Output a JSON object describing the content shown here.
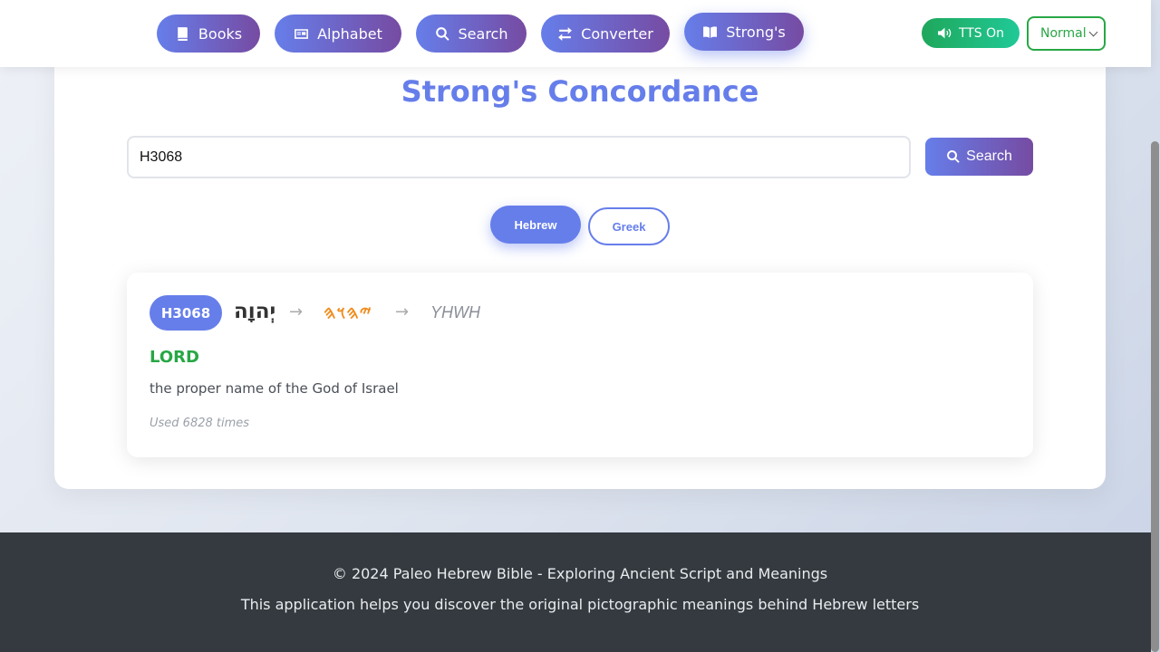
{
  "nav": {
    "items": [
      {
        "label": "Books",
        "icon": "book-icon"
      },
      {
        "label": "Alphabet",
        "icon": "id-card-icon"
      },
      {
        "label": "Search",
        "icon": "search-icon"
      },
      {
        "label": "Converter",
        "icon": "exchange-icon"
      },
      {
        "label": "Strong's",
        "icon": "open-book-icon",
        "active": true
      }
    ],
    "tts_label": "TTS On",
    "speed_value": "Normal"
  },
  "page": {
    "title": "Strong's Concordance"
  },
  "search": {
    "value": "H3068",
    "button_label": "Search"
  },
  "language_toggle": {
    "options": [
      "Hebrew",
      "Greek"
    ],
    "selected": "Hebrew"
  },
  "result": {
    "strongs_number": "H3068",
    "hebrew": "יְהוָה",
    "arrow": "→",
    "paleo": "𐤉𐤄𐤅𐤄",
    "transliteration": "YHWH",
    "gloss": "LORD",
    "definition": "the proper name of the God of Israel",
    "usage": "Used 6828 times"
  },
  "footer": {
    "copyright": "© 2024 Paleo Hebrew Bible - Exploring Ancient Script and Meanings",
    "tagline": "This application helps you discover the original pictographic meanings behind Hebrew letters"
  },
  "colors": {
    "accent": "#667eea",
    "accent_end": "#764ba2",
    "success": "#28a745",
    "paleo": "#f08c1e",
    "footer_bg": "#343a40"
  }
}
